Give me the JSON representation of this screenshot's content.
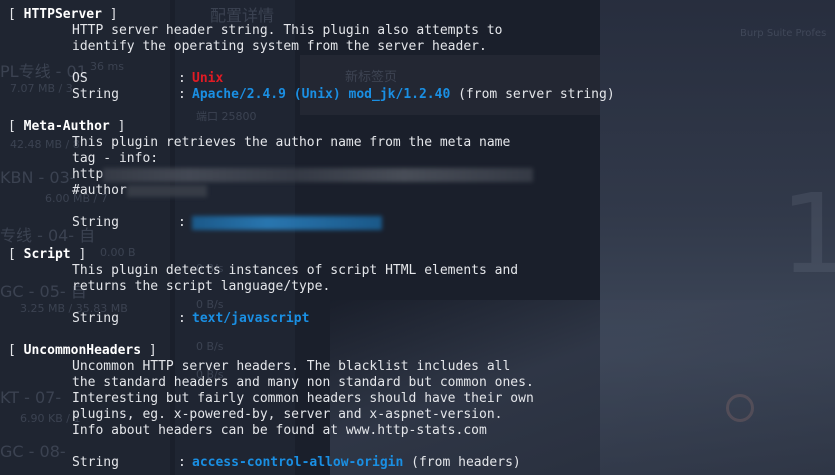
{
  "background": {
    "ghost_texts": [
      "配置详情",
      "PL专线 - 01",
      "7.07 MB / 3",
      "42.48 MB / 8",
      "KBN - 03-",
      "6.00 MB / 7",
      "专线 - 04- 自",
      "GC - 05- 自",
      "3.25 MB / 35.83 MB",
      "KT - 07-",
      "6.90 KB / 1",
      "GC - 08-",
      "新标签页",
      "端口 25800",
      "Burp Suite Profes",
      "0 B/s",
      "0 B/s",
      "0 B/s",
      "0 B/s",
      "36 ms",
      "0.00 B"
    ],
    "big_digit": "1"
  },
  "plugins": {
    "httpserver": {
      "name": "HTTPServer",
      "desc": [
        "HTTP server header string. This plugin also attempts to",
        "identify the operating system from the server header."
      ],
      "os_key": "OS",
      "os_value": "Unix",
      "string_key": "String",
      "string_value": "Apache/2.4.9 (Unix) mod_jk/1.2.40",
      "string_note": "(from server string)"
    },
    "meta_author": {
      "name": "Meta-Author",
      "desc": [
        "This plugin retrieves the author name from the meta name",
        "tag - info:"
      ],
      "url_prefix": "http",
      "author_tag": "#author",
      "string_key": "String"
    },
    "script": {
      "name": "Script",
      "desc": [
        "This plugin detects instances of script HTML elements and",
        "returns the script language/type."
      ],
      "string_key": "String",
      "string_value": "text/javascript"
    },
    "uncommon_headers": {
      "name": "UncommonHeaders",
      "desc": [
        "Uncommon HTTP server headers. The blacklist includes all",
        "the standard headers and many non standard but common ones.",
        "Interesting but fairly common headers should have their own",
        "plugins, eg. x-powered-by, server and x-aspnet-version.",
        "Info about headers can be found at www.http-stats.com"
      ],
      "string_key": "String",
      "string_value": "access-control-allow-origin",
      "string_note": "(from headers)"
    }
  },
  "symbols": {
    "open": "[ ",
    "close": " ]",
    "colon": ":"
  }
}
